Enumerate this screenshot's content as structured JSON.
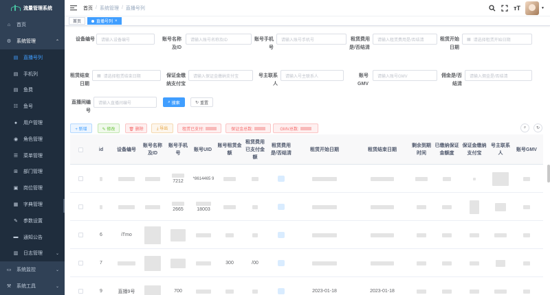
{
  "app": {
    "title": "流量管理系统"
  },
  "sidebar": {
    "items": [
      {
        "label": "首页",
        "icon": "home-icon"
      },
      {
        "label": "系统管理",
        "icon": "system-icon",
        "expanded": true
      },
      {
        "label": "系统监控",
        "icon": "monitor-icon"
      },
      {
        "label": "系统工具",
        "icon": "tool-icon"
      }
    ],
    "sub_items": [
      {
        "label": "直播号列",
        "icon": "list-icon",
        "active": true
      },
      {
        "label": "手机列",
        "icon": "list-icon"
      },
      {
        "label": "鱼费",
        "icon": "list-icon"
      },
      {
        "label": "鱼号",
        "icon": "list-icon"
      },
      {
        "label": "用户管理",
        "icon": "user-icon"
      },
      {
        "label": "角色管理",
        "icon": "role-icon"
      },
      {
        "label": "菜单管理",
        "icon": "menu-icon"
      },
      {
        "label": "部门管理",
        "icon": "tree-icon"
      },
      {
        "label": "岗位管理",
        "icon": "post-icon"
      },
      {
        "label": "字典管理",
        "icon": "dict-icon"
      },
      {
        "label": "参数设置",
        "icon": "edit-icon"
      },
      {
        "label": "通知公告",
        "icon": "message-icon"
      },
      {
        "label": "日志管理",
        "icon": "log-icon"
      }
    ]
  },
  "header": {
    "breadcrumb": [
      "首页",
      "系统管理",
      "直播号列"
    ],
    "icons": [
      "search-icon",
      "fullscreen-icon",
      "font-size-icon"
    ]
  },
  "tags": [
    {
      "label": "首页",
      "active": false
    },
    {
      "label": "直播号列",
      "active": true,
      "close": "×"
    }
  ],
  "search": {
    "fields": [
      {
        "label": "设备编号",
        "placeholder": "请输入设备编号"
      },
      {
        "label": "账号名称及ID",
        "placeholder": "请输入账号名称及ID"
      },
      {
        "label": "账号手机号",
        "placeholder": "请输入账号手机号"
      },
      {
        "label": "租赁费用是/否结清",
        "placeholder": "请输入租赁费用是/否结清"
      },
      {
        "label": "租赁开始日期",
        "placeholder": "请选择租赁开始日期",
        "date": true
      },
      {
        "label": "租赁结束日期",
        "placeholder": "请选择租赁结束日期",
        "date": true
      },
      {
        "label": "保证金缴纳支付宝",
        "placeholder": "请输入保证金缴纳支付宝"
      },
      {
        "label": "号主联系人",
        "placeholder": "请输入号主联系人"
      },
      {
        "label": "账号GMV",
        "placeholder": "请输入账号GMV"
      },
      {
        "label": "佣金是/否结清",
        "placeholder": "请输入佣金是/否结清"
      },
      {
        "label": "直播间编号",
        "placeholder": "请输入直播间编号"
      }
    ],
    "search_label": "搜索",
    "reset_label": "重置"
  },
  "toolbar": {
    "add": "+ 新增",
    "edit": "✎ 修改",
    "delete": "🗑 删除",
    "export": "⤓ 导出",
    "rent_paid": "租赁已支付:",
    "deposit_total": "保证金总数:",
    "gmv_total": "GMV总数:"
  },
  "table": {
    "columns": [
      "id",
      "设备编号",
      "账号名称及ID",
      "账号手机号",
      "账号UID",
      "账号租赁金额",
      "租赁费用已支付金额",
      "租赁费用是/否结清",
      "租赁开始日期",
      "租赁结束日期",
      "剩余到期时间",
      "已缴纳保证金额度",
      "保证金缴纳支付宝",
      "号主联系人",
      "账号GMV"
    ],
    "rows": [
      {
        "id": "",
        "phone": "7212",
        "uid": "*8614465 9"
      },
      {
        "id": "",
        "phone": "2665",
        "uid": "18003"
      },
      {
        "id": "6",
        "device": "iTmo",
        "phone": "",
        "uid": ""
      },
      {
        "id": "7",
        "phone": "",
        "uid": "",
        "rent": "300",
        "paid": "/00"
      },
      {
        "id": "9",
        "device": "直播9号",
        "phone": "700",
        "uid": "",
        "start": "2023-01-18",
        "end": "2023-01-18"
      }
    ]
  }
}
